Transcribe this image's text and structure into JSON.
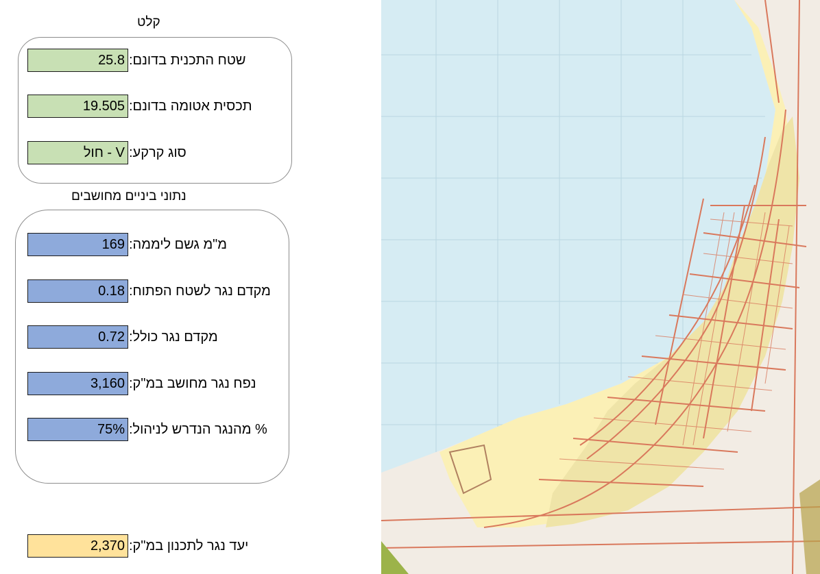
{
  "soil_section": {
    "title": "קלט",
    "rows": [
      {
        "label": "שטח התכנית בדונם:",
        "value": "25.8"
      },
      {
        "label": "תכסית אטומה בדונם:",
        "value": "19.505"
      },
      {
        "label": "סוג קרקע:",
        "value": "חול - V"
      }
    ]
  },
  "computed_section": {
    "title": "נתוני ביניים מחושבים",
    "rows": [
      {
        "label": "מ\"מ גשם ליממה:",
        "value": "169"
      },
      {
        "label": "מקדם נגר לשטח הפתוח:",
        "value": "0.18"
      },
      {
        "label": "מקדם נגר כולל:",
        "value": "0.72"
      },
      {
        "label": "נפח נגר מחושב במ\"ק:",
        "value": "3,160"
      },
      {
        "label": "% מהנגר הנדרש לניהול:",
        "value": "75%"
      }
    ]
  },
  "target": {
    "label": "יעד נגר לתכנון במ\"ק:",
    "value": "2,370"
  },
  "colors": {
    "input_cell": "#c8e0b4",
    "computed_cell": "#8eaadb",
    "target_cell": "#ffe29b",
    "sea": "#d6ecf3",
    "plan_area": "#fbf0b6",
    "roads": "#d9785c"
  },
  "map": {
    "name": "plan-area-map-image"
  }
}
